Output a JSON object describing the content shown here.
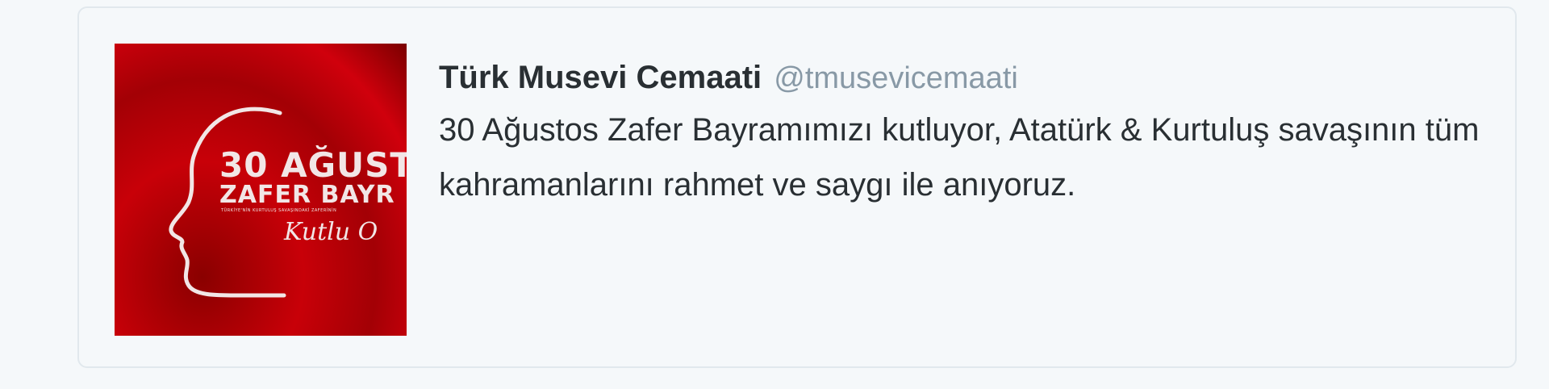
{
  "tweet": {
    "author_name": "Türk Musevi Cemaati",
    "author_handle": "@tmusevicemaati",
    "text": "30 Ağustos Zafer Bayramımızı kutluyor, Atatürk & Kurtuluş savaşının tüm kahramanlarını rahmet ve saygı ile anıyoruz."
  },
  "media": {
    "line1": "30 AĞUST",
    "line2": "ZAFER BAYR",
    "line3": "TÜRKİYE'NİN KURTULUŞ SAVAŞINDAKİ ZAFERİNİN",
    "line4": "Kutlu O",
    "background_color": "#c80008"
  }
}
